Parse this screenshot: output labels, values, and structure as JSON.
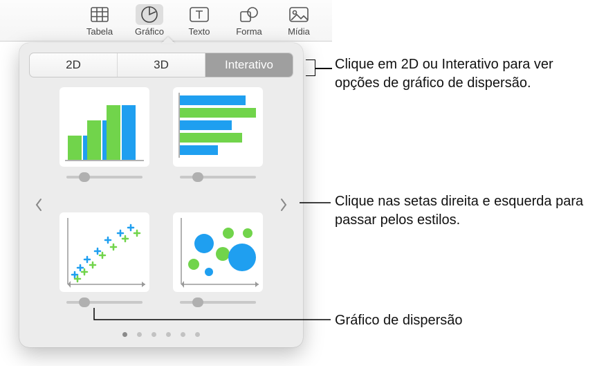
{
  "toolbar": {
    "items": [
      {
        "label": "Tabela",
        "icon": "table-icon"
      },
      {
        "label": "Gráfico",
        "icon": "chart-icon"
      },
      {
        "label": "Texto",
        "icon": "text-icon"
      },
      {
        "label": "Forma",
        "icon": "shape-icon"
      },
      {
        "label": "Mídia",
        "icon": "media-icon"
      }
    ],
    "selected_index": 1
  },
  "popover": {
    "tabs": {
      "tab_2d": "2D",
      "tab_3d": "3D",
      "tab_interactive": "Interativo"
    },
    "active_tab": "tab_interactive",
    "charts": [
      {
        "name": "column-chart",
        "type": "column"
      },
      {
        "name": "bar-chart",
        "type": "bar"
      },
      {
        "name": "scatter-chart",
        "type": "scatter"
      },
      {
        "name": "bubble-chart",
        "type": "bubble"
      }
    ],
    "page_count": 6,
    "page_index": 0
  },
  "callouts": {
    "tabs_hint": "Clique em 2D ou Interativo para ver opções de gráfico de dispersão.",
    "arrows_hint": "Clique nas setas direita e esquerda para passar pelos estilos.",
    "scatter_label": "Gráfico de dispersão"
  },
  "colors": {
    "green": "#71d44b",
    "blue": "#1f9ff0"
  }
}
